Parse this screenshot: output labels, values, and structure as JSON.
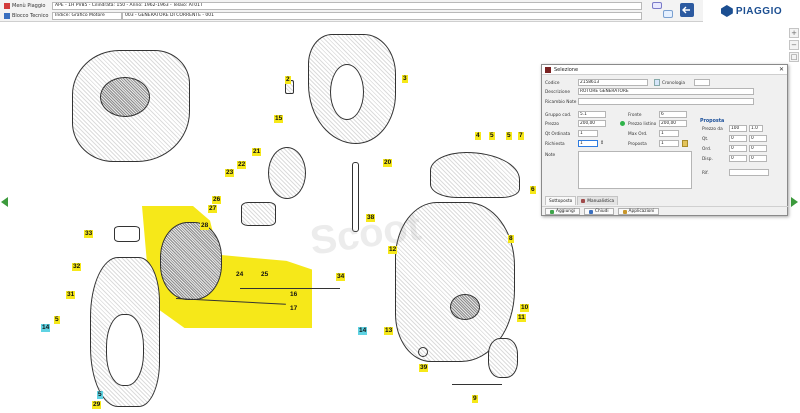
{
  "header": {
    "row1": {
      "label": "Menù Piaggio",
      "value": "APE - 1H PV85 - Cilindrata: 150 - Anno: 1962-1963 - Telaio: AT01T"
    },
    "row2": {
      "label": "Blocco Tecnico",
      "index_label": "Indice: Grafico Motore",
      "value": "003 - GENERATORE DI CORRENTE - 001"
    },
    "brand": "PIAGGIO"
  },
  "diagram": {
    "callouts": [
      {
        "n": "2"
      },
      {
        "n": "3"
      },
      {
        "n": "15"
      },
      {
        "n": "21"
      },
      {
        "n": "22"
      },
      {
        "n": "23"
      },
      {
        "n": "20"
      },
      {
        "n": "4"
      },
      {
        "n": "5"
      },
      {
        "n": "7"
      },
      {
        "n": "5"
      },
      {
        "n": "6"
      },
      {
        "n": "26"
      },
      {
        "n": "27"
      },
      {
        "n": "28"
      },
      {
        "n": "33"
      },
      {
        "n": "38"
      },
      {
        "n": "12"
      },
      {
        "n": "8"
      },
      {
        "n": "32"
      },
      {
        "n": "24"
      },
      {
        "n": "25"
      },
      {
        "n": "34"
      },
      {
        "n": "16"
      },
      {
        "n": "31"
      },
      {
        "n": "17"
      },
      {
        "n": "14"
      },
      {
        "n": "5"
      },
      {
        "n": "10"
      },
      {
        "n": "11"
      },
      {
        "n": "14"
      },
      {
        "n": "13"
      },
      {
        "n": "39"
      },
      {
        "n": "5"
      },
      {
        "n": "29"
      },
      {
        "n": "9"
      }
    ],
    "watermark": "Scoot"
  },
  "dialog": {
    "title": "Selezione",
    "fields": {
      "codice_label": "Codice",
      "codice": "2158613",
      "cronologia_label": "Cronologia",
      "descrizione_label": "Descrizione",
      "descrizione": "ROTORE GENERATORE",
      "ricambio_note_label": "Ricambio Note",
      "gruppo_label": "Gruppo cod.",
      "gruppo": "5.1",
      "fronte_label": "Fronte",
      "fronte": "6",
      "prezzo_label": "Prezzo",
      "prezzo": "200,00",
      "prezzo_listino_label": "Prezzo listino",
      "prezzo_listino": "200,00",
      "qt_ordinata_label": "Qt Ordinata",
      "qt_ordinata": "1",
      "max_ord_label": "Max Ord.",
      "max_ord": "1",
      "qt_richiesta_label": "Richiesta",
      "qt_richiesta": "1",
      "proposta_label": "Proposta",
      "proposta": "1",
      "note_label": "Note"
    },
    "properties": {
      "title": "Proposta",
      "rows": [
        {
          "label": "Prezzo da",
          "a": "100",
          "b": "1.0"
        },
        {
          "label": "Qt.",
          "a": "0",
          "b": "0"
        },
        {
          "label": "Ord.",
          "a": "0",
          "b": "0"
        },
        {
          "label": "Disp.",
          "a": "0",
          "b": "0"
        },
        {
          "label": "Rif.",
          "a": "",
          "b": ""
        }
      ]
    },
    "tabs": [
      "Sottoposto",
      "Manualistica"
    ],
    "buttons": [
      "Aggiungi",
      "Chiudi",
      "Applicazioni"
    ]
  },
  "colors": {
    "highlight": "#f6e819",
    "callout_cyan": "#5fd3e3",
    "brand": "#1b4e91",
    "nav_green": "#3c9a3c"
  }
}
